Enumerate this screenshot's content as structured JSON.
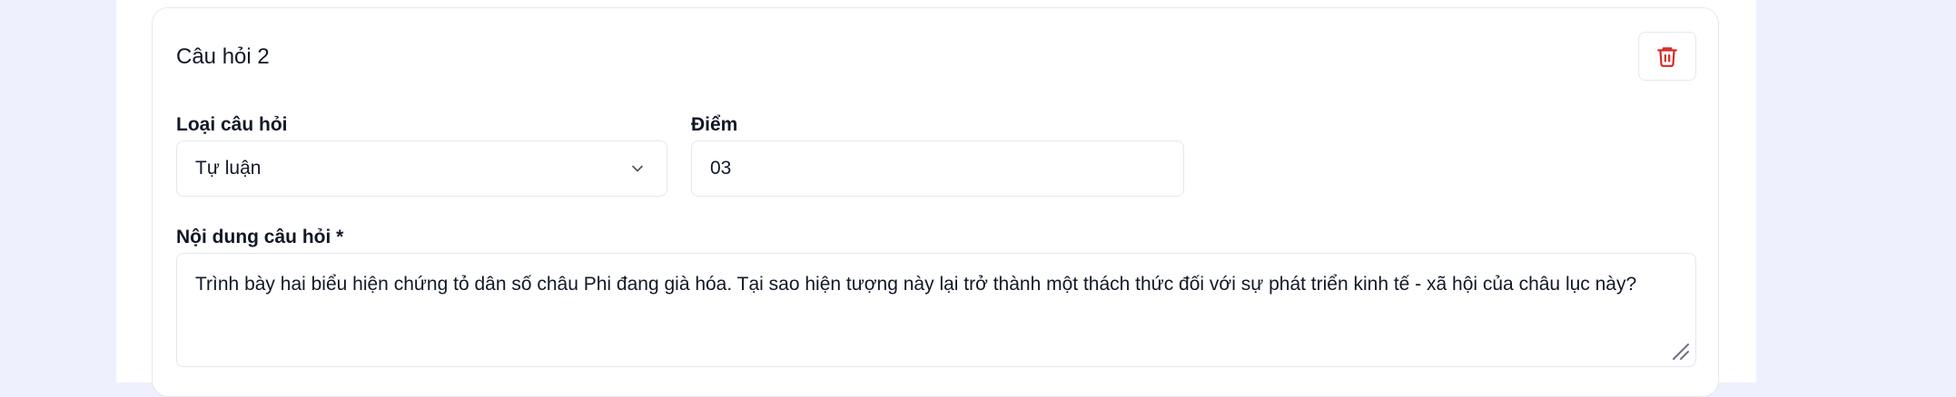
{
  "question": {
    "title": "Câu hỏi 2",
    "type_label": "Loại câu hỏi",
    "type_value": "Tự luận",
    "score_label": "Điểm",
    "score_value": "03",
    "content_label": "Nội dung câu hỏi *",
    "content_value": "Trình bày hai biểu hiện chứng tỏ dân số châu Phi đang già hóa. Tại sao hiện tượng này lại trở thành một thách thức đối với sự phát triển kinh tế - xã hội của châu lục này?"
  },
  "icons": {
    "delete": "trash-icon",
    "dropdown": "chevron-down-icon",
    "resize": "resize-handle-icon"
  },
  "colors": {
    "background": "#eef1fd",
    "panel": "#ffffff",
    "border": "#e5e7eb",
    "danger": "#dc2626",
    "text": "#111827"
  }
}
